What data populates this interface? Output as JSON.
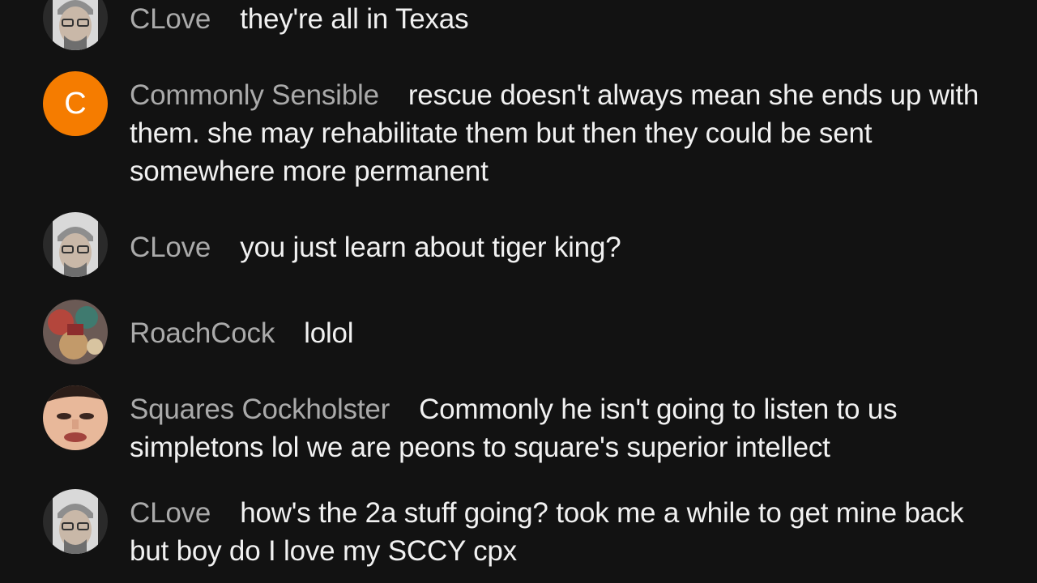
{
  "colors": {
    "background": "#121212",
    "author_text": "#aaaaaa",
    "message_text": "#f1f1f1",
    "letter_avatar_bg": "#f57c00"
  },
  "messages": [
    {
      "author": "CLove",
      "text": "they're all in Texas",
      "avatar": "man-with-cap-glasses-photo"
    },
    {
      "author": "Commonly Sensible",
      "text": "rescue doesn't always mean she ends up with them. she may rehabilitate them but then they could be sent somewhere more permanent",
      "avatar": "letter",
      "avatar_letter": "C"
    },
    {
      "author": "CLove",
      "text": "you just learn about tiger king?",
      "avatar": "man-with-cap-glasses-photo"
    },
    {
      "author": "RoachCock",
      "text": "lolol",
      "avatar": "colorful-photo"
    },
    {
      "author": "Squares Cockholster",
      "text": "Commonly he isn't going to listen to us simpletons lol we are peons to square's superior intellect",
      "avatar": "face-closeup-photo"
    },
    {
      "author": "CLove",
      "text": "how's the 2a stuff going? took me a while to get mine back but boy do I love my SCCY cpx",
      "avatar": "man-with-cap-glasses-photo"
    }
  ]
}
